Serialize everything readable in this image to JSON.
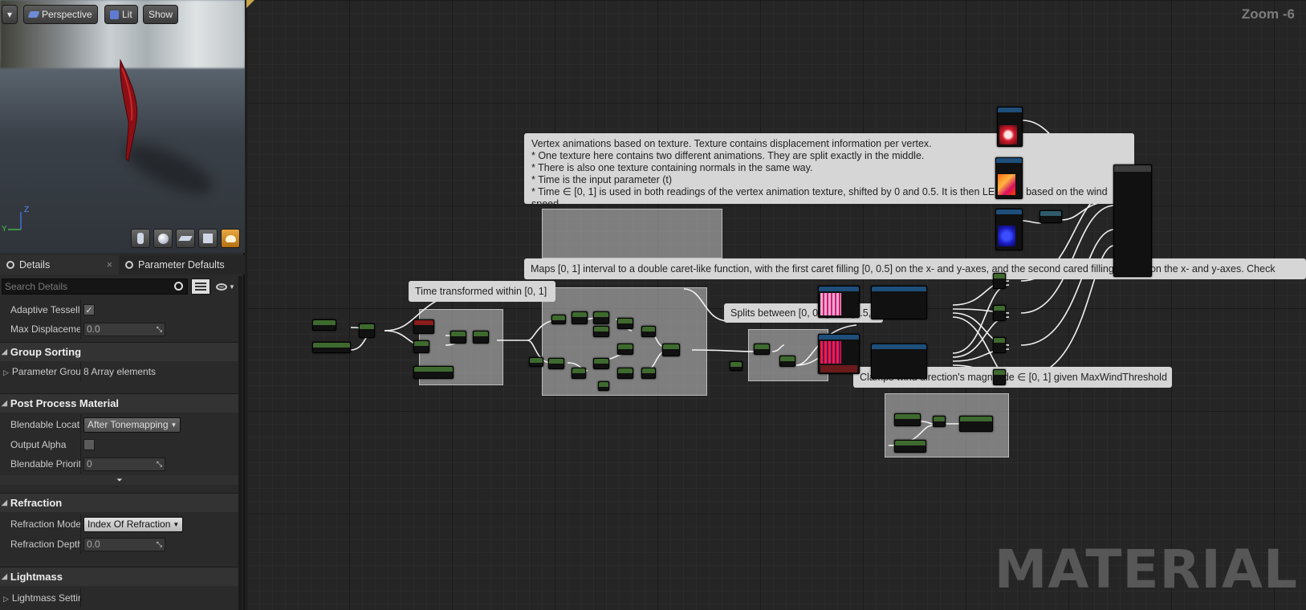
{
  "viewport": {
    "menu_label": "▾",
    "perspective_label": "Perspective",
    "lit_label": "Lit",
    "show_label": "Show",
    "axis_z": "Z",
    "axis_y": "Y",
    "view_modes": [
      "cylinder-icon",
      "sphere-icon",
      "plane-icon",
      "cube-icon",
      "teapot-icon"
    ]
  },
  "tabs": {
    "details": "Details",
    "close": "×",
    "parameter_defaults": "Parameter Defaults"
  },
  "search": {
    "placeholder": "Search Details"
  },
  "properties": {
    "adaptive_tessellation": {
      "name": "Adaptive Tessellation",
      "checked": true
    },
    "max_displacement": {
      "name": "Max Displacement",
      "value": "0.0"
    },
    "group_sorting": {
      "title": "Group Sorting"
    },
    "parameter_groups": {
      "name": "Parameter Groups",
      "value": "8 Array elements"
    },
    "post_process": {
      "title": "Post Process Material"
    },
    "blendable_location": {
      "name": "Blendable Location",
      "value": "After Tonemapping"
    },
    "output_alpha": {
      "name": "Output Alpha",
      "checked": false
    },
    "blendable_priority": {
      "name": "Blendable Priority",
      "value": "0"
    },
    "refraction": {
      "title": "Refraction"
    },
    "refraction_mode": {
      "name": "Refraction Mode",
      "value": "Index Of Refraction"
    },
    "refraction_depth_bias": {
      "name": "Refraction Depth Bias",
      "value": "0.0"
    },
    "lightmass": {
      "title": "Lightmass"
    },
    "lightmass_settings": {
      "name": "Lightmass Settings"
    }
  },
  "graph": {
    "zoom": "Zoom -6",
    "watermark": "MATERIAL",
    "comment_main": "Vertex animations based on texture. Texture contains displacement information per vertex.\n* One texture here contains two different animations. They are split exactly in the middle.\n* There is also one texture containing normals in the same way.\n* Time is the input parameter (t)\n* Time ∈ [0, 1] is used in both readings of the vertex animation texture, shifted by 0 and 0.5. It is then LERP-ed based on the wind speed.",
    "comment_maps": "Maps [0, 1] interval to a double caret-like function, with the first caret filling [0, 0.5] on the x- and y-axes, and the second cared filling [0.5, 1] on the x- and y-axes. Check",
    "comment_time": "Time transformed within [0, 1]",
    "comment_splits": "Splits between [0, 0.5] and [0.5, 1]",
    "comment_clamps": "Clamps wind direction's magnitude ∈ [0, 1] given MaxWindThreshold"
  }
}
